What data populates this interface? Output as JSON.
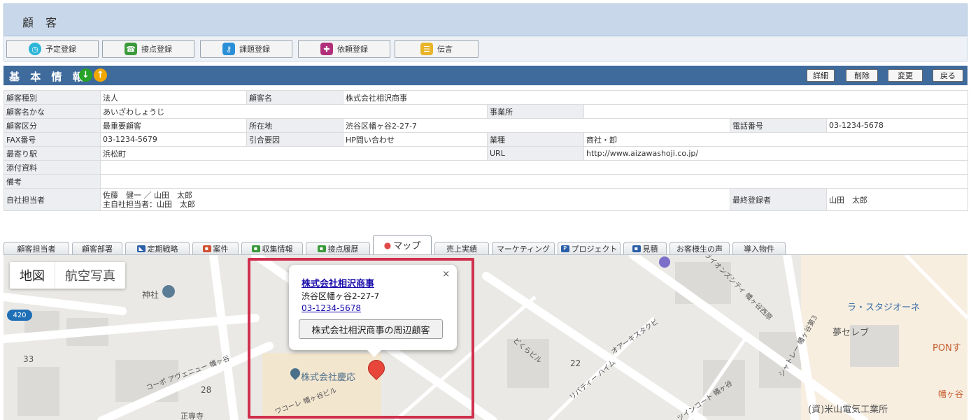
{
  "header": {
    "title": "顧 客"
  },
  "actions": [
    {
      "label": "予定登録",
      "icon": "clock-icon",
      "color": "#2bb5d8"
    },
    {
      "label": "接点登録",
      "icon": "contact-icon",
      "color": "#3b9a3b"
    },
    {
      "label": "課題登録",
      "icon": "key-icon",
      "color": "#2b8fd8"
    },
    {
      "label": "依頼登録",
      "icon": "gift-icon",
      "color": "#b0307a"
    },
    {
      "label": "伝言",
      "icon": "memo-icon",
      "color": "#e8b52a"
    }
  ],
  "section": {
    "title": "基 本 情 報",
    "buttons": {
      "detail": "詳細",
      "delete": "削除",
      "edit": "変更",
      "back": "戻る"
    },
    "down_color": "#27a327",
    "up_color": "#f0a800"
  },
  "info": {
    "customer_type_label": "顧客種別",
    "customer_type": "法人",
    "customer_name_label": "顧客名",
    "customer_name": "株式会社相沢商事",
    "kana_label": "顧客名かな",
    "kana": "あいざわしょうじ",
    "office_label": "事業所",
    "office": "",
    "category_label": "顧客区分",
    "category": "最重要顧客",
    "address_label": "所在地",
    "address": "渋谷区幡ヶ谷2-27-7",
    "tel_label": "電話番号",
    "tel": "03-1234-5678",
    "fax_label": "FAX番号",
    "fax": "03-1234-5679",
    "referral_label": "引合要因",
    "referral": "HP問い合わせ",
    "industry_label": "業種",
    "industry": "商社・卸",
    "station_label": "最寄り駅",
    "station": "浜松町",
    "url_label": "URL",
    "url": "http://www.aizawashoji.co.jp/",
    "attachments_label": "添付資料",
    "notes_label": "備考",
    "owner_label": "自社担当者",
    "owner_line1": "佐藤　健一 ／ 山田　太郎",
    "owner_line2": "主自社担当者：山田　太郎",
    "last_editor_label": "最終登録者",
    "last_editor": "山田　太郎"
  },
  "tabs": [
    {
      "label": "顧客担当者"
    },
    {
      "label": "顧客部署"
    },
    {
      "label": "定期戦略",
      "icon": "strategy-icon",
      "color": "#2b5fa8"
    },
    {
      "label": "案件",
      "icon": "case-icon",
      "color": "#d05030"
    },
    {
      "label": "収集情報",
      "icon": "collect-icon",
      "color": "#3a9a3a"
    },
    {
      "label": "接点履歴",
      "icon": "history-icon",
      "color": "#3a9a3a"
    },
    {
      "label": "マップ",
      "icon": "pin-icon",
      "color": "#e04a4a",
      "active": true
    },
    {
      "label": "売上実績"
    },
    {
      "label": "マーケティング"
    },
    {
      "label": "プロジェクト",
      "icon": "project-icon",
      "color": "#2b5fa8"
    },
    {
      "label": "見積",
      "icon": "estimate-icon",
      "color": "#2b5fa8"
    },
    {
      "label": "お客様生の声"
    },
    {
      "label": "導入物件"
    }
  ],
  "map": {
    "type_map": "地図",
    "type_satellite": "航空写真",
    "route_number": "420",
    "popup": {
      "name": "株式会社相沢商事",
      "address": "渋谷区幡ヶ谷2-27-7",
      "tel": "03-1234-5678",
      "nearby_button": "株式会社相沢商事の周辺顧客",
      "close": "×"
    },
    "places": {
      "shrine": "神社",
      "lasuta": "ラ・スタジオーネ",
      "yume": "夢セレブ",
      "pon": "PONす",
      "keio": "株式会社慶応",
      "yoneyama": "(資)米山電気工業所",
      "hatagaya": "幡ヶ谷",
      "koopo": "コーポ\nアヴェニュー\n幡ヶ谷",
      "kotsubu": "ワコーレ\n幡ヶ谷ビル",
      "lions": "ライオンズシティ\n幡ヶ谷西原",
      "oasis": "オアーキスタクビ",
      "dokura": "どくらビル",
      "libertie": "リバティー\nハイム",
      "chateau": "シャトレー\n幡ヶ谷第3",
      "twincourt": "ツインコート\n幡ヶ谷",
      "sho": "正専寺",
      "num33": "33",
      "num28": "28",
      "num22": "22"
    }
  }
}
